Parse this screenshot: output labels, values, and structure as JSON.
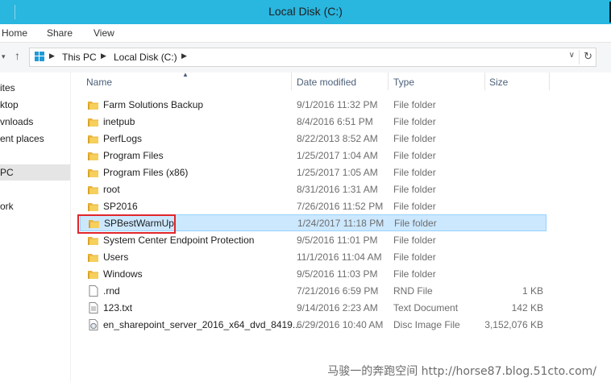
{
  "window": {
    "title": "Local Disk (C:)"
  },
  "ribbon": {
    "tabs": [
      "Home",
      "Share",
      "View"
    ]
  },
  "address": {
    "crumbs": [
      "This PC",
      "Local Disk (C:)"
    ]
  },
  "navpane": {
    "items": [
      "ites",
      "ktop",
      "vnloads",
      "ent places",
      "PC",
      "ork"
    ],
    "selected_index": 4
  },
  "columns": {
    "name": "Name",
    "date": "Date modified",
    "type": "Type",
    "size": "Size"
  },
  "files": [
    {
      "name": "Farm Solutions Backup",
      "date": "9/1/2016 11:32 PM",
      "type": "File folder",
      "size": "",
      "icon": "folder-icon"
    },
    {
      "name": "inetpub",
      "date": "8/4/2016 6:51 PM",
      "type": "File folder",
      "size": "",
      "icon": "folder-icon"
    },
    {
      "name": "PerfLogs",
      "date": "8/22/2013 8:52 AM",
      "type": "File folder",
      "size": "",
      "icon": "folder-icon"
    },
    {
      "name": "Program Files",
      "date": "1/25/2017 1:04 AM",
      "type": "File folder",
      "size": "",
      "icon": "folder-icon"
    },
    {
      "name": "Program Files (x86)",
      "date": "1/25/2017 1:05 AM",
      "type": "File folder",
      "size": "",
      "icon": "folder-icon"
    },
    {
      "name": "root",
      "date": "8/31/2016 1:31 AM",
      "type": "File folder",
      "size": "",
      "icon": "folder-icon"
    },
    {
      "name": "SP2016",
      "date": "7/26/2016 11:52 PM",
      "type": "File folder",
      "size": "",
      "icon": "folder-icon"
    },
    {
      "name": "SPBestWarmUp",
      "date": "1/24/2017 11:18 PM",
      "type": "File folder",
      "size": "",
      "icon": "folder-icon",
      "selected": true
    },
    {
      "name": "System Center Endpoint Protection",
      "date": "9/5/2016 11:01 PM",
      "type": "File folder",
      "size": "",
      "icon": "folder-icon"
    },
    {
      "name": "Users",
      "date": "11/1/2016 11:04 AM",
      "type": "File folder",
      "size": "",
      "icon": "folder-icon"
    },
    {
      "name": "Windows",
      "date": "9/5/2016 11:03 PM",
      "type": "File folder",
      "size": "",
      "icon": "folder-icon"
    },
    {
      "name": ".rnd",
      "date": "7/21/2016 6:59 PM",
      "type": "RND File",
      "size": "1 KB",
      "icon": "file-icon"
    },
    {
      "name": "123.txt",
      "date": "9/14/2016 2:23 AM",
      "type": "Text Document",
      "size": "142 KB",
      "icon": "text-file-icon"
    },
    {
      "name": "en_sharepoint_server_2016_x64_dvd_8419...",
      "date": "6/29/2016 10:40 AM",
      "type": "Disc Image File",
      "size": "3,152,076 KB",
      "icon": "disc-image-icon"
    }
  ],
  "watermark": "马骏一的奔跑空间 http://horse87.blog.51cto.com/",
  "colors": {
    "titlebar": "#29b6df",
    "selection_bg": "#cce8ff",
    "highlight_box": "#e0262b"
  }
}
